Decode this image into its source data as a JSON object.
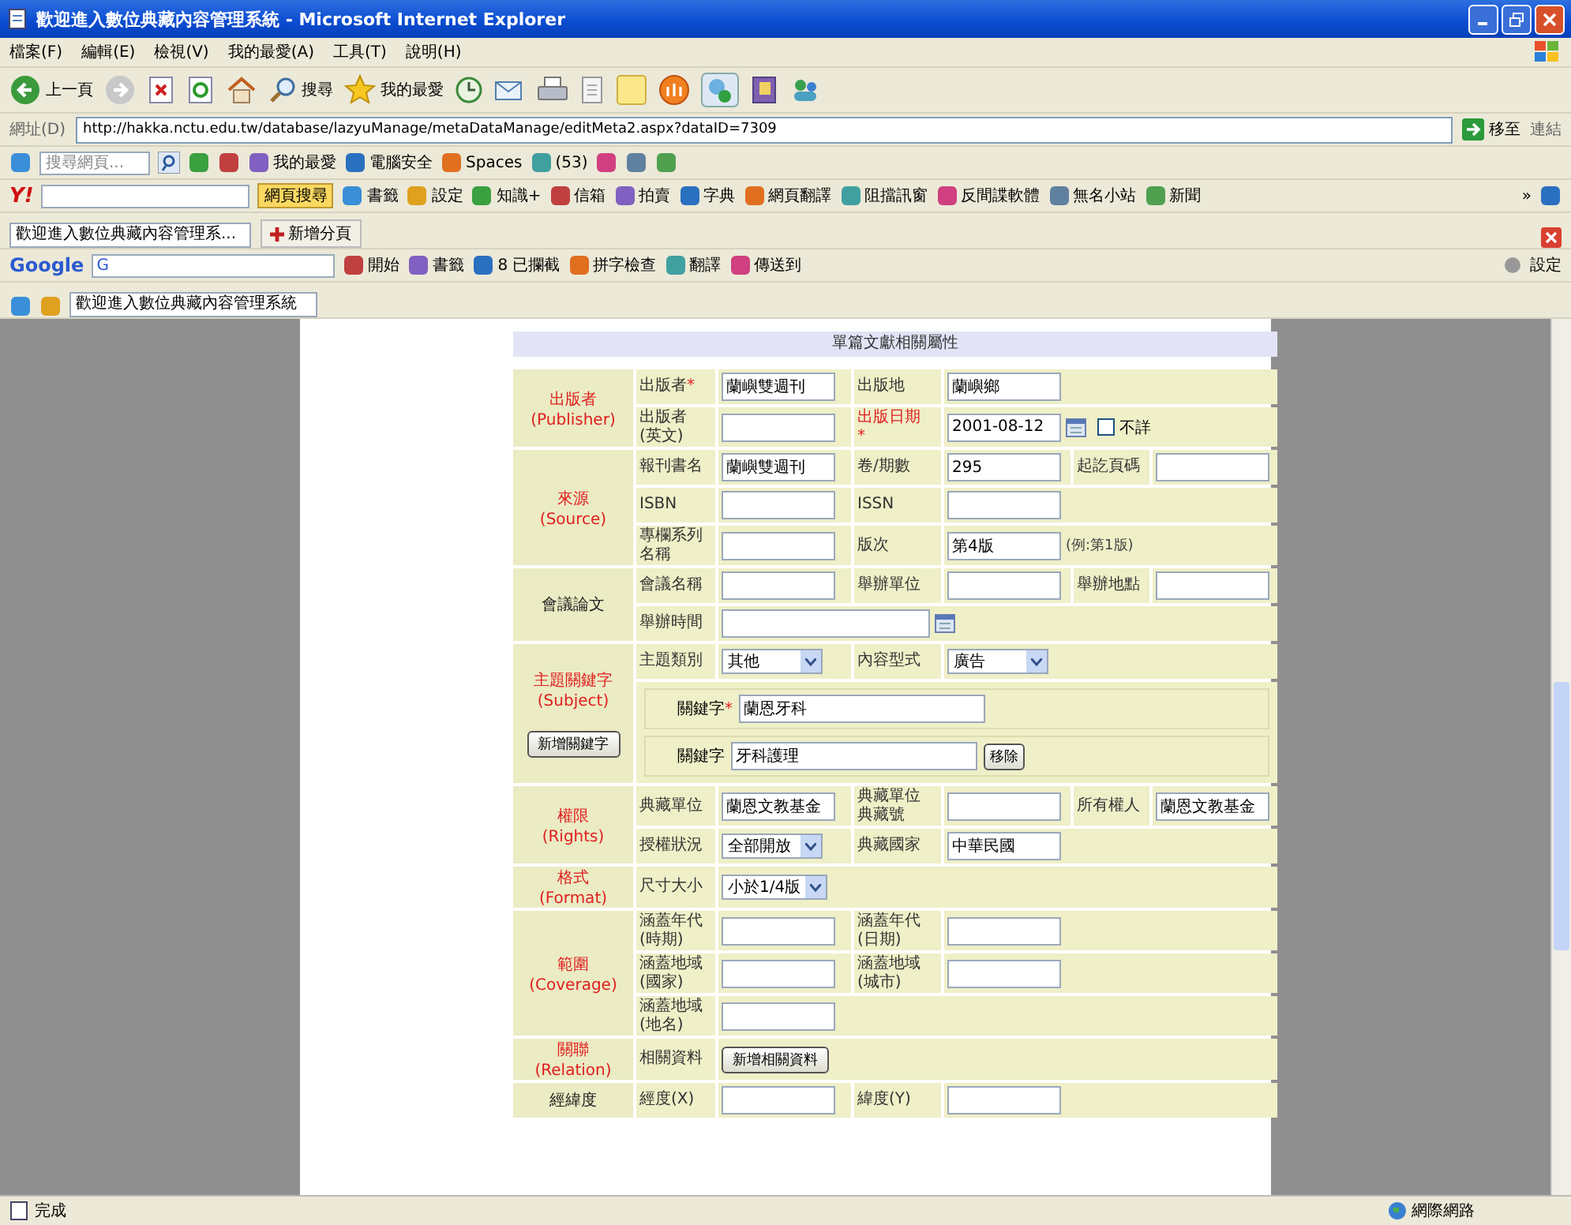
{
  "window": {
    "title": "歡迎進入數位典藏內容管理系統 - Microsoft Internet Explorer"
  },
  "menu": [
    "檔案(F)",
    "編輯(E)",
    "檢視(V)",
    "我的最愛(A)",
    "工具(T)",
    "說明(H)"
  ],
  "toolbar": [
    {
      "kind": "back",
      "label": "上一頁"
    },
    {
      "kind": "forward"
    },
    {
      "kind": "stop"
    },
    {
      "kind": "refresh"
    },
    {
      "kind": "home"
    },
    {
      "kind": "search",
      "label": "搜尋"
    },
    {
      "kind": "favorites",
      "label": "我的最愛"
    },
    {
      "kind": "history"
    },
    {
      "kind": "mail"
    },
    {
      "kind": "print"
    },
    {
      "kind": "edit"
    },
    {
      "kind": "note"
    },
    {
      "kind": "round"
    },
    {
      "kind": "messenger"
    },
    {
      "kind": "research"
    },
    {
      "kind": "people"
    }
  ],
  "address": {
    "label": "網址(D)",
    "url": "http://hakka.nctu.edu.tw/database/lazyuManage/metaDataManage/editMeta2.aspx?dataID=7309",
    "go": "移至",
    "links": "連結"
  },
  "links_bar": {
    "search_placeholder": "搜尋網頁...",
    "items": [
      "我的最愛",
      "電腦安全",
      "Spaces",
      "(53)"
    ]
  },
  "yahoo_bar": {
    "logo": "Y!",
    "search_button": "網頁搜尋",
    "items": [
      "書籤",
      "設定",
      "知識+",
      "信箱",
      "拍賣",
      "字典",
      "網頁翻譯",
      "阻擋訊窗",
      "反間諜軟體",
      "無名小站",
      "新聞"
    ],
    "overflow": "»"
  },
  "tabs": [
    {
      "label": "歡迎進入數位典藏內容管理系...",
      "selected": true
    }
  ],
  "new_tab": "新增分頁",
  "google_bar": {
    "logo": "Google",
    "field": "G",
    "items": [
      "開始",
      "書籤",
      "8 已攔截",
      "拼字檢查",
      "翻譯",
      "傳送到"
    ],
    "settings": "設定"
  },
  "favorites_tabs": [
    {
      "label": "歡迎進入數位典藏內容管理系統",
      "selected": true
    }
  ],
  "form": {
    "title": "單篇文獻相關屬性",
    "required_mark": "*",
    "sections": [
      {
        "title": "出版者",
        "subtitle": "(Publisher)",
        "highlighted": true,
        "rows": [
          [
            {
              "kind": "label",
              "text": "出版者",
              "required": true,
              "highlighted": false
            },
            {
              "kind": "input",
              "value": "蘭嶼雙週刊"
            },
            {
              "kind": "label",
              "text": "出版地",
              "required": false,
              "highlighted": false
            },
            {
              "kind": "input",
              "value": "蘭嶼鄉"
            }
          ],
          [
            {
              "kind": "label",
              "text": "出版者\n(英文)",
              "required": false,
              "highlighted": false
            },
            {
              "kind": "input"
            },
            {
              "kind": "label",
              "text": "出版日期",
              "required": true,
              "highlighted": true
            },
            {
              "kind": "date",
              "value": "2001-08-12",
              "checkbox": {
                "label": "不詳",
                "checked": false
              }
            }
          ]
        ]
      },
      {
        "title": "來源",
        "subtitle": "(Source)",
        "highlighted": true,
        "rows": [
          [
            {
              "kind": "label",
              "text": "報刊書名",
              "required": false,
              "highlighted": false
            },
            {
              "kind": "input",
              "value": "蘭嶼雙週刊"
            },
            {
              "kind": "label",
              "text": "卷/期數",
              "required": false,
              "highlighted": false
            },
            {
              "kind": "input",
              "value": "295"
            },
            {
              "kind": "label",
              "text": "起訖頁碼",
              "required": false,
              "highlighted": false
            },
            {
              "kind": "input"
            }
          ],
          [
            {
              "kind": "label",
              "text": "ISBN",
              "required": false,
              "highlighted": false
            },
            {
              "kind": "input"
            },
            {
              "kind": "label",
              "text": "ISSN",
              "required": false,
              "highlighted": false
            },
            {
              "kind": "input"
            }
          ],
          [
            {
              "kind": "label",
              "text": "專欄系列名稱",
              "required": false,
              "highlighted": false
            },
            {
              "kind": "input"
            },
            {
              "kind": "label",
              "text": "版次",
              "required": false,
              "highlighted": false
            },
            {
              "kind": "input",
              "value": "第4版",
              "note": "(例:第1版)"
            }
          ]
        ]
      },
      {
        "title": "會議論文",
        "highlighted": false,
        "rows": [
          [
            {
              "kind": "label",
              "text": "會議名稱",
              "required": false,
              "highlighted": false
            },
            {
              "kind": "input"
            },
            {
              "kind": "label",
              "text": "舉辦單位",
              "required": false,
              "highlighted": false
            },
            {
              "kind": "input"
            },
            {
              "kind": "label",
              "text": "舉辦地點",
              "required": false,
              "highlighted": false
            },
            {
              "kind": "input"
            }
          ],
          [
            {
              "kind": "label",
              "text": "舉辦時間",
              "required": false,
              "highlighted": false
            },
            {
              "kind": "date"
            }
          ]
        ]
      },
      {
        "title": "主題關鍵字",
        "subtitle": "(Subject)",
        "highlighted": true,
        "button": "新增關鍵字",
        "rows": [
          [
            {
              "kind": "label",
              "text": "主題類別",
              "required": false,
              "highlighted": false
            },
            {
              "kind": "select",
              "value": "其他"
            },
            {
              "kind": "label",
              "text": "內容型式",
              "required": false,
              "highlighted": false
            },
            {
              "kind": "select",
              "value": "廣告"
            }
          ],
          [
            {
              "kind": "keywords",
              "entries": [
                {
                  "label": "關鍵字",
                  "required": true,
                  "value": "蘭恩牙科"
                },
                {
                  "label": "關鍵字",
                  "required": false,
                  "value": "牙科護理",
                  "remove": "移除"
                }
              ]
            }
          ]
        ]
      },
      {
        "title": "權限",
        "subtitle": "(Rights)",
        "highlighted": true,
        "rows": [
          [
            {
              "kind": "label",
              "text": "典藏單位",
              "required": false,
              "highlighted": false
            },
            {
              "kind": "input",
              "value": "蘭恩文教基金"
            },
            {
              "kind": "label",
              "text": "典藏單位典藏號",
              "required": false,
              "highlighted": false
            },
            {
              "kind": "input"
            },
            {
              "kind": "label",
              "text": "所有權人",
              "required": false,
              "highlighted": false
            },
            {
              "kind": "input",
              "value": "蘭恩文教基金"
            }
          ],
          [
            {
              "kind": "label",
              "text": "授權狀況",
              "required": false,
              "highlighted": false
            },
            {
              "kind": "select",
              "value": "全部開放"
            },
            {
              "kind": "label",
              "text": "典藏國家",
              "required": false,
              "highlighted": false
            },
            {
              "kind": "input",
              "value": "中華民國"
            }
          ]
        ]
      },
      {
        "title": "格式",
        "subtitle": "(Format)",
        "highlighted": true,
        "rows": [
          [
            {
              "kind": "label",
              "text": "尺寸大小",
              "required": false,
              "highlighted": false
            },
            {
              "kind": "select",
              "value": "小於1/4版"
            }
          ]
        ]
      },
      {
        "title": "範圍",
        "subtitle": "(Coverage)",
        "highlighted": true,
        "rows": [
          [
            {
              "kind": "label",
              "text": "涵蓋年代\n(時期)",
              "required": false,
              "highlighted": false
            },
            {
              "kind": "input"
            },
            {
              "kind": "label",
              "text": "涵蓋年代\n(日期)",
              "required": false,
              "highlighted": false
            },
            {
              "kind": "input"
            }
          ],
          [
            {
              "kind": "label",
              "text": "涵蓋地域\n(國家)",
              "required": false,
              "highlighted": false
            },
            {
              "kind": "input"
            },
            {
              "kind": "label",
              "text": "涵蓋地域\n(城市)",
              "required": false,
              "highlighted": false
            },
            {
              "kind": "input"
            }
          ],
          [
            {
              "kind": "label",
              "text": "涵蓋地域\n(地名)",
              "required": false,
              "highlighted": false
            },
            {
              "kind": "input"
            }
          ]
        ]
      },
      {
        "title": "關聯",
        "subtitle": "(Relation)",
        "highlighted": true,
        "rows": [
          [
            {
              "kind": "label",
              "text": "相關資料",
              "required": false,
              "highlighted": false
            },
            {
              "kind": "button",
              "label": "新增相關資料"
            }
          ]
        ]
      },
      {
        "title": "經緯度",
        "highlighted": false,
        "rows": [
          [
            {
              "kind": "label",
              "text": "經度(X)",
              "required": false,
              "highlighted": false
            },
            {
              "kind": "input"
            },
            {
              "kind": "label",
              "text": "緯度(Y)",
              "required": false,
              "highlighted": false
            },
            {
              "kind": "input"
            }
          ]
        ]
      }
    ]
  },
  "status_bar": {
    "text": "完成",
    "zone": "網際網路"
  }
}
